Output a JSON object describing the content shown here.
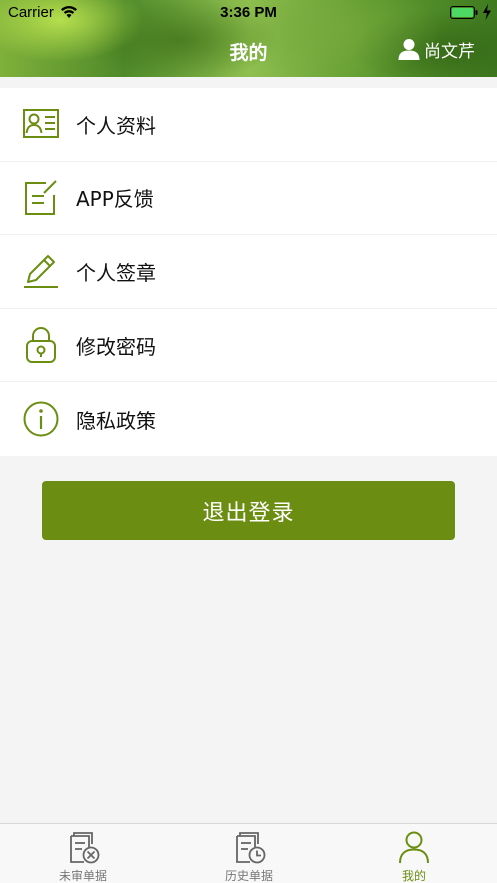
{
  "status_bar": {
    "carrier": "Carrier",
    "time": "3:36 PM"
  },
  "header": {
    "title": "我的",
    "user_name": "尚文芹"
  },
  "menu": {
    "items": [
      {
        "label": "个人资料",
        "icon": "profile-card-icon"
      },
      {
        "label": "APP反馈",
        "icon": "feedback-icon"
      },
      {
        "label": "个人签章",
        "icon": "pen-signature-icon"
      },
      {
        "label": "修改密码",
        "icon": "lock-icon"
      },
      {
        "label": "隐私政策",
        "icon": "info-icon"
      }
    ]
  },
  "logout_label": "退出登录",
  "tabbar": {
    "tabs": [
      {
        "label": "未审单据",
        "icon": "pending-docs-icon",
        "active": false
      },
      {
        "label": "历史单据",
        "icon": "history-docs-icon",
        "active": false
      },
      {
        "label": "我的",
        "icon": "user-icon",
        "active": true
      }
    ]
  },
  "colors": {
    "accent": "#6b8e12",
    "icon": "#6b8e12",
    "tab_inactive": "#666666",
    "background": "#f4f4f4"
  }
}
